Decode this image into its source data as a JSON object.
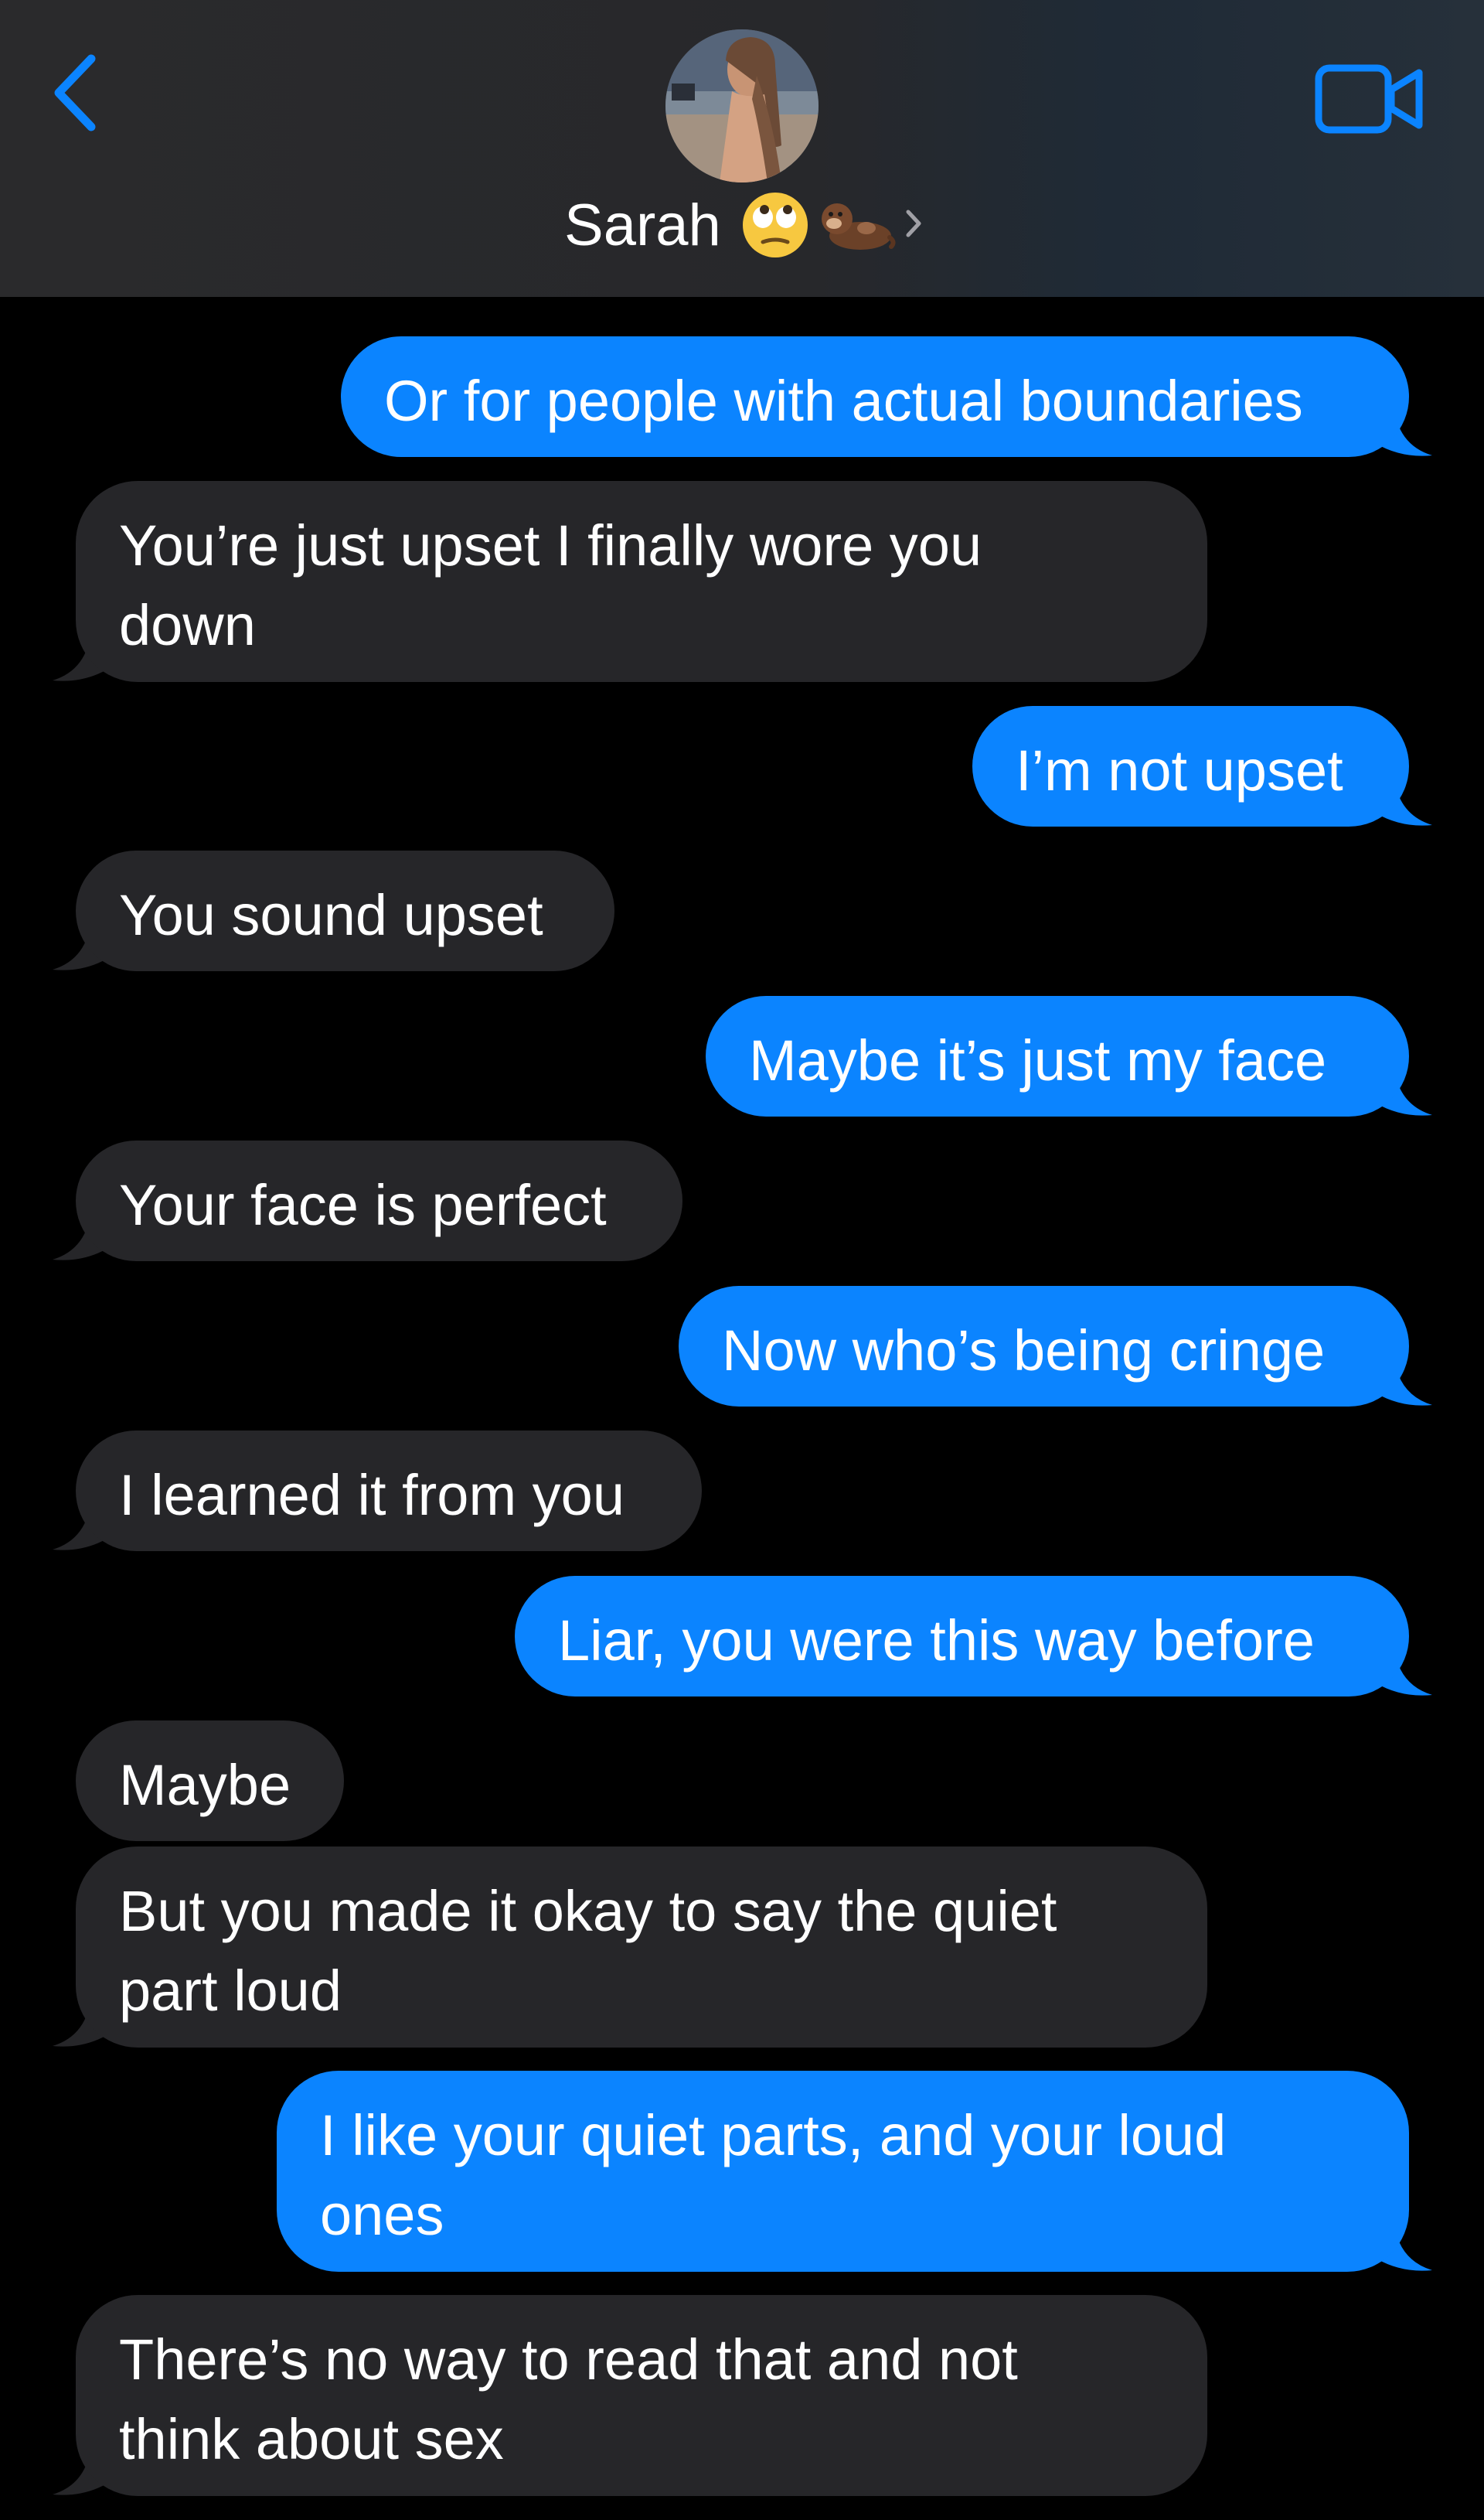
{
  "header": {
    "back_icon": "chevron-left-icon",
    "contact_name": "Sarah",
    "contact_emojis": "🙄🦦",
    "chevron_icon": "chevron-right-icon",
    "video_icon": "video-camera-icon",
    "accent_color": "#0b84ff"
  },
  "colors": {
    "outgoing_bubble": "#0b84ff",
    "incoming_bubble": "#262629",
    "background": "#000000",
    "text": "#ffffff"
  },
  "messages": [
    {
      "direction": "outgoing",
      "text": "Or for people with actual boundaries"
    },
    {
      "direction": "incoming",
      "text": "You’re just upset I finally wore you\ndown"
    },
    {
      "direction": "outgoing",
      "text": "I’m not upset"
    },
    {
      "direction": "incoming",
      "text": "You sound upset"
    },
    {
      "direction": "outgoing",
      "text": "Maybe it’s just my face"
    },
    {
      "direction": "incoming",
      "text": "Your face is perfect"
    },
    {
      "direction": "outgoing",
      "text": "Now who’s being cringe"
    },
    {
      "direction": "incoming",
      "text": "I learned it from you"
    },
    {
      "direction": "outgoing",
      "text": "Liar, you were this way before"
    },
    {
      "direction": "incoming",
      "text": "Maybe"
    },
    {
      "direction": "incoming",
      "text": "But you made it okay to say the quiet\npart loud"
    },
    {
      "direction": "outgoing",
      "text": "I like your quiet parts, and your loud\nones"
    },
    {
      "direction": "incoming",
      "text": "There’s no way to read that and not\nthink about sex"
    }
  ]
}
